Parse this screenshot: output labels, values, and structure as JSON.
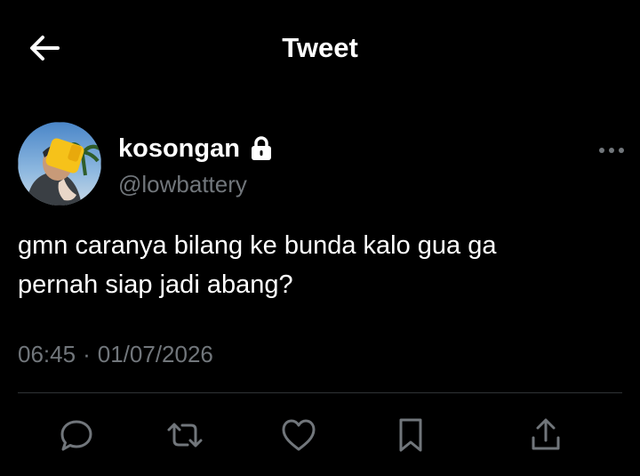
{
  "header": {
    "title": "Tweet",
    "back_icon": "arrow-left-icon"
  },
  "author": {
    "display_name": "kosongan",
    "handle": "@lowbattery",
    "protected_icon": "lock-icon"
  },
  "tweet": {
    "text": "gmn caranya bilang ke bunda kalo gua ga\npernah siap jadi abang?",
    "time": "06:45",
    "separator": "·",
    "date": "01/07/2026"
  },
  "actions": [
    {
      "name": "reply",
      "icon": "reply-icon"
    },
    {
      "name": "retweet",
      "icon": "retweet-icon"
    },
    {
      "name": "like",
      "icon": "heart-icon"
    },
    {
      "name": "bookmark",
      "icon": "bookmark-icon"
    },
    {
      "name": "share",
      "icon": "share-icon"
    }
  ],
  "colors": {
    "background": "#000000",
    "text_primary": "#ffffff",
    "text_secondary": "#71767b",
    "divider": "#2f3336"
  }
}
